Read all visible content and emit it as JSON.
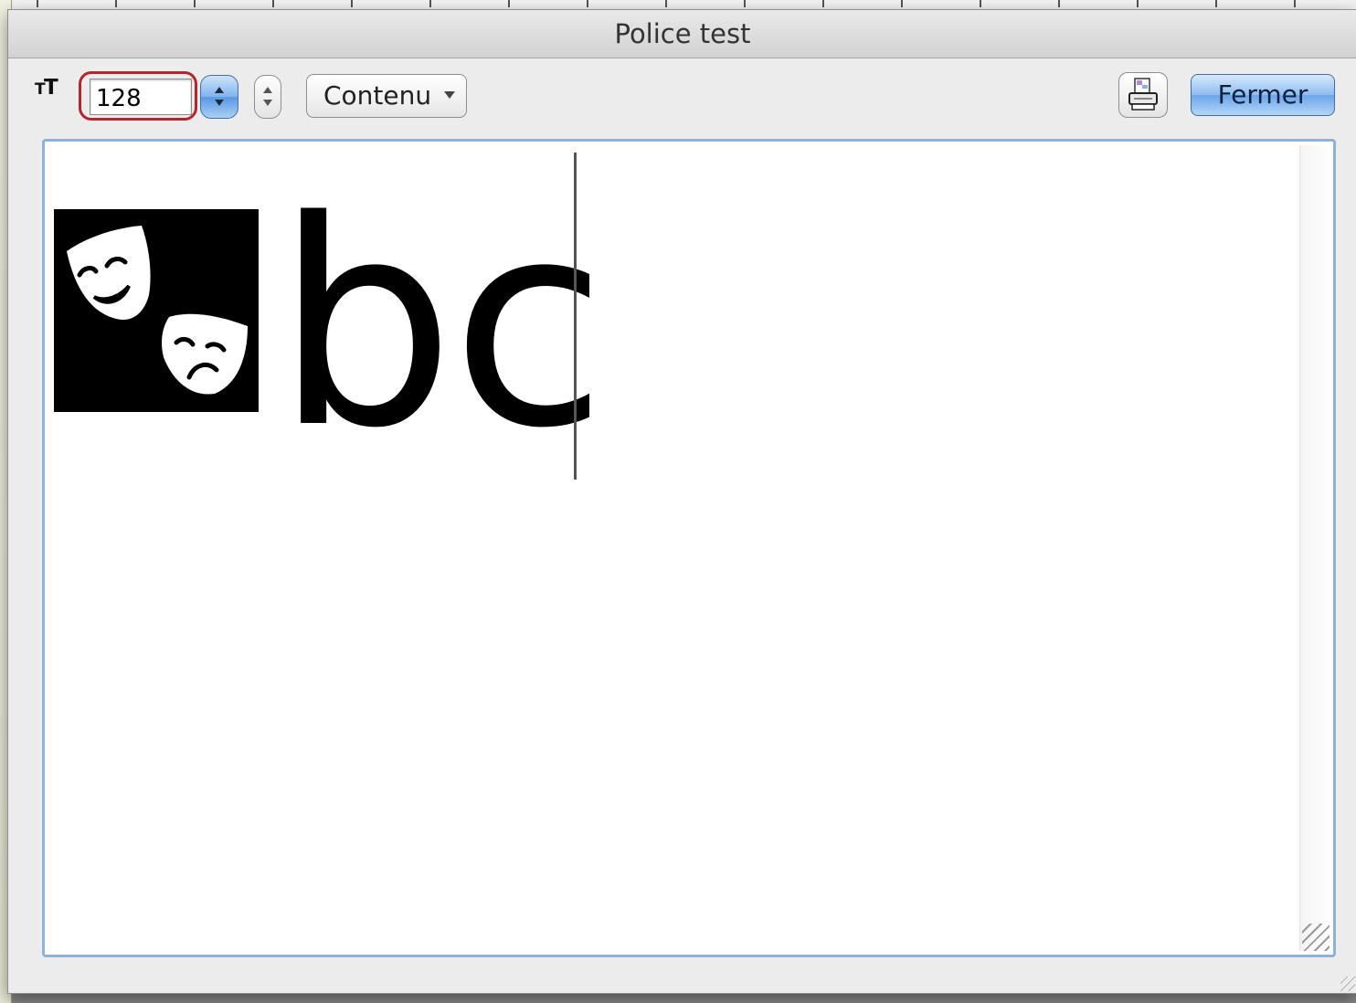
{
  "window": {
    "title": "Police test"
  },
  "toolbar": {
    "font_size_icon": "font-size-icon",
    "font_size_value": "128",
    "view_popup_label": "Contenu",
    "print_icon": "printer-icon",
    "close_label": "Fermer"
  },
  "editor": {
    "glyph_image": "theater-masks-glyph",
    "sample_text": "bc"
  },
  "colors": {
    "focus_ring": "#b3262c",
    "editor_border": "#8fb1de",
    "default_button": "#6ba5ea"
  }
}
